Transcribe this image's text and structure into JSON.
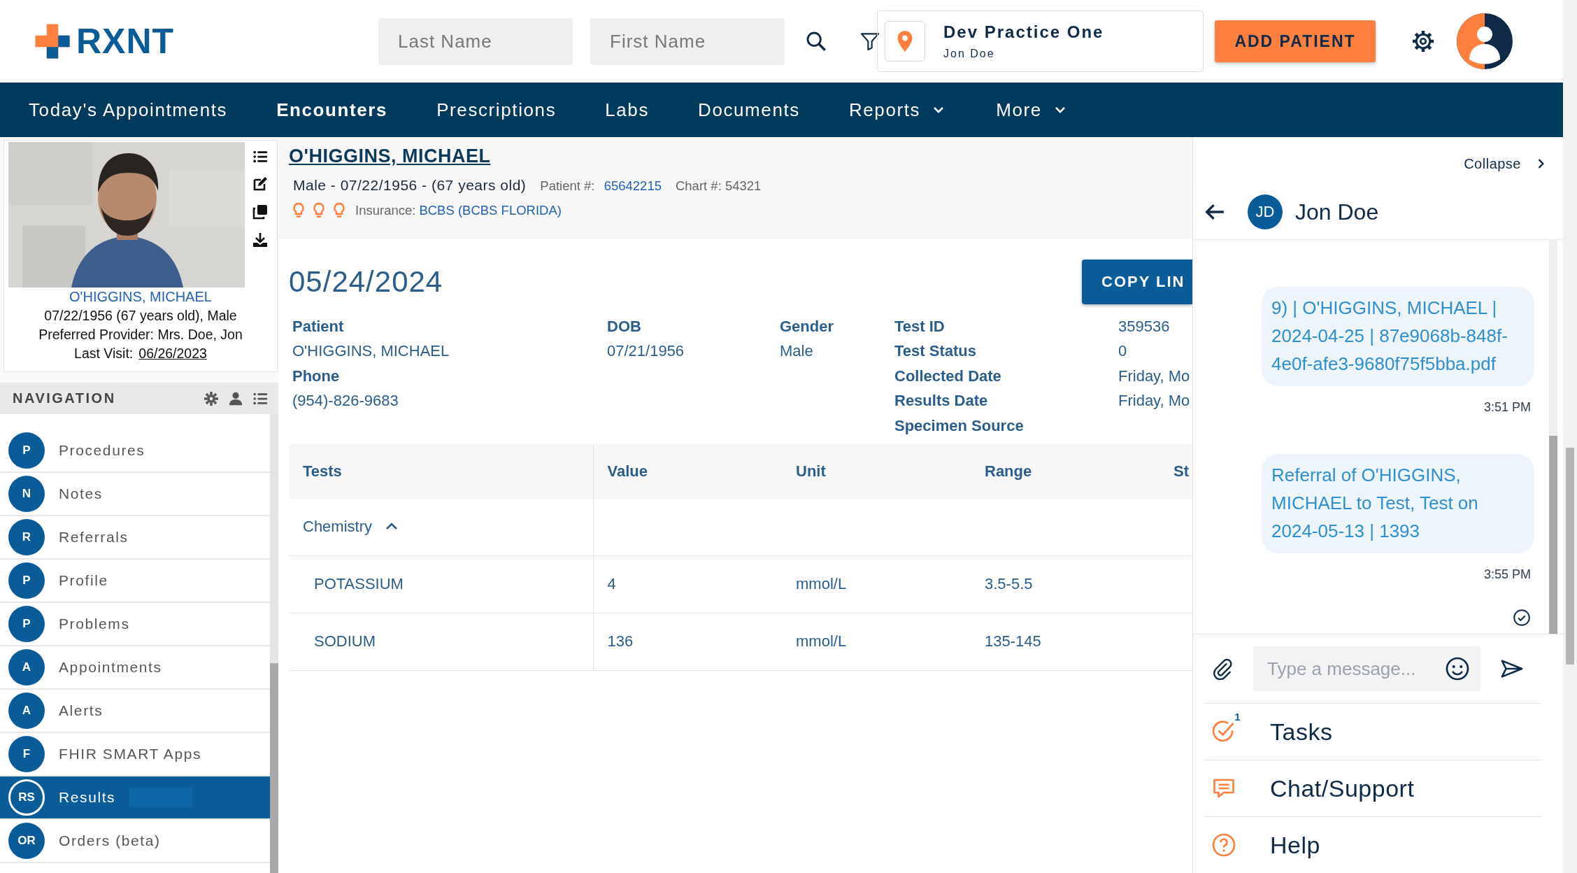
{
  "header": {
    "logo": "RXNT",
    "last_name": {
      "placeholder": "Last Name"
    },
    "first_name": {
      "placeholder": "First Name"
    },
    "practice": {
      "name": "Dev Practice One",
      "user": "Jon Doe"
    },
    "add_patient": "ADD PATIENT"
  },
  "nav": [
    {
      "label": "Today's Appointments",
      "selected": false,
      "has_menu": false
    },
    {
      "label": "Encounters",
      "selected": true,
      "has_menu": false
    },
    {
      "label": "Prescriptions",
      "selected": false,
      "has_menu": false
    },
    {
      "label": "Labs",
      "selected": false,
      "has_menu": false
    },
    {
      "label": "Documents",
      "selected": false,
      "has_menu": false
    },
    {
      "label": "Reports",
      "selected": false,
      "has_menu": true
    },
    {
      "label": "More",
      "selected": false,
      "has_menu": true
    }
  ],
  "patient_card": {
    "name": "O'HIGGINS, MICHAEL",
    "details": "07/22/1956 (67 years old), Male",
    "provider": "Preferred Provider: Mrs. Doe, Jon",
    "last_visit_label": "Last Visit:",
    "last_visit": "06/26/2023"
  },
  "navigation": {
    "title": "NAVIGATION",
    "items": [
      {
        "badge": "P",
        "label": "Procedures",
        "selected": false
      },
      {
        "badge": "N",
        "label": "Notes",
        "selected": false
      },
      {
        "badge": "R",
        "label": "Referrals",
        "selected": false
      },
      {
        "badge": "P",
        "label": "Profile",
        "selected": false
      },
      {
        "badge": "P",
        "label": "Problems",
        "selected": false
      },
      {
        "badge": "A",
        "label": "Appointments",
        "selected": false
      },
      {
        "badge": "A",
        "label": "Alerts",
        "selected": false
      },
      {
        "badge": "F",
        "label": "FHIR SMART Apps",
        "selected": false
      },
      {
        "badge": "RS",
        "label": "Results",
        "selected": true
      },
      {
        "badge": "OR",
        "label": "Orders (beta)",
        "selected": false
      }
    ]
  },
  "patient_header": {
    "name": "O'HIGGINS, MICHAEL",
    "demographics": "Male - 07/22/1956 - (67 years old)",
    "patient_number_label": "Patient #:",
    "patient_number": "65642215",
    "chart": "Chart #: 54321",
    "insurance_label": "Insurance:",
    "insurance": "BCBS (BCBS FLORIDA)"
  },
  "result": {
    "date": "05/24/2024",
    "copy_button": "COPY LIN",
    "patient_fields": [
      {
        "label": "Patient",
        "value": "O'HIGGINS, MICHAEL"
      },
      {
        "label": "Phone",
        "value": "(954)-826-9683"
      }
    ],
    "dob": {
      "label": "DOB",
      "value": "07/21/1956"
    },
    "gender": {
      "label": "Gender",
      "value": "Male"
    },
    "test_fields": [
      {
        "label": "Test ID",
        "value": "359536"
      },
      {
        "label": "Test Status",
        "value": "0"
      },
      {
        "label": "Collected Date",
        "value": "Friday, Mo"
      },
      {
        "label": "Results Date",
        "value": "Friday, Mo"
      },
      {
        "label": "Specimen Source"
      }
    ]
  },
  "table": {
    "columns": [
      "Tests",
      "Value",
      "Unit",
      "Range",
      "St"
    ],
    "group": {
      "name": "Chemistry",
      "expanded": true
    },
    "rows": [
      [
        "POTASSIUM",
        "4",
        "mmol/L",
        "3.5-5.5"
      ],
      [
        "SODIUM",
        "136",
        "mmol/L",
        "135-145"
      ]
    ]
  },
  "chat": {
    "collapse": "Collapse",
    "contact": {
      "initials": "JD",
      "name": "Jon Doe"
    },
    "messages": [
      {
        "text": "9) | O'HIGGINS, MICHAEL | 2024-04-25 | 87e9068b-848f-4e0f-afe3-9680f75f5bba.pdf",
        "time": "3:51 PM"
      },
      {
        "text": "Referral of O'HIGGINS, MICHAEL to Test, Test on 2024-05-13 | 1393",
        "time": "3:55 PM"
      }
    ],
    "read": true,
    "placeholder": "Type a message...",
    "menu": [
      {
        "kind": "tasks",
        "label": "Tasks",
        "badge": "1"
      },
      {
        "kind": "chat",
        "label": "Chat/Support"
      },
      {
        "kind": "help",
        "label": "Help"
      }
    ]
  }
}
